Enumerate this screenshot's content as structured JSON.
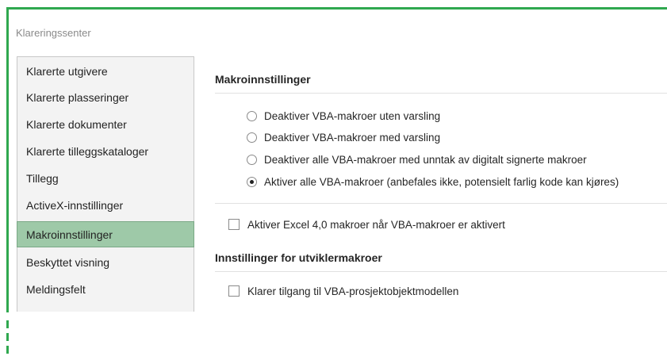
{
  "dialog": {
    "title": "Klareringssenter"
  },
  "sidebar": {
    "items": [
      {
        "label": "Klarerte utgivere"
      },
      {
        "label": "Klarerte plasseringer"
      },
      {
        "label": "Klarerte dokumenter"
      },
      {
        "label": "Klarerte tilleggskataloger"
      },
      {
        "label": "Tillegg"
      },
      {
        "label": "ActiveX-innstillinger"
      },
      {
        "label": "Makroinnstillinger",
        "selected": true
      },
      {
        "label": "Beskyttet visning"
      },
      {
        "label": "Meldingsfelt"
      }
    ]
  },
  "macro_settings": {
    "title": "Makroinnstillinger",
    "options": [
      {
        "label": "Deaktiver VBA-makroer uten varsling",
        "selected": false
      },
      {
        "label": "Deaktiver VBA-makroer med varsling",
        "selected": false
      },
      {
        "label": "Deaktiver alle VBA-makroer med unntak av digitalt signerte makroer",
        "selected": false
      },
      {
        "label": "Aktiver alle VBA-makroer (anbefales ikke, potensielt farlig kode kan kjøres)",
        "selected": true
      }
    ],
    "excel4_checkbox": {
      "label": "Aktiver Excel 4,0 makroer når VBA-makroer er aktivert",
      "checked": false
    }
  },
  "developer_settings": {
    "title": "Innstillinger for utviklermakroer",
    "vba_object_model_checkbox": {
      "label": "Klarer tilgang til VBA-prosjektobjektmodellen",
      "checked": false
    }
  },
  "colors": {
    "accent_green": "#2fa84f",
    "selected_item": "#9ec9a8"
  }
}
